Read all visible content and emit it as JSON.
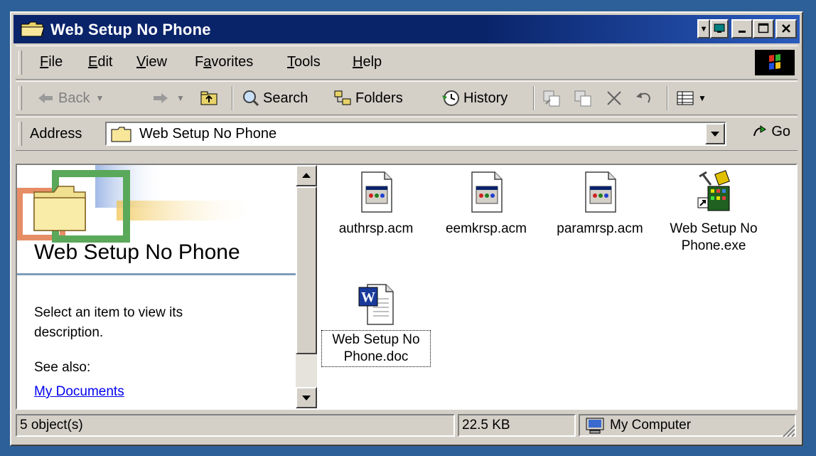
{
  "window": {
    "title": "Web Setup No Phone"
  },
  "menu": {
    "items": [
      {
        "label": "File",
        "key": "F"
      },
      {
        "label": "Edit",
        "key": "E"
      },
      {
        "label": "View",
        "key": "V"
      },
      {
        "label": "Favorites",
        "key": "a"
      },
      {
        "label": "Tools",
        "key": "T"
      },
      {
        "label": "Help",
        "key": "H"
      }
    ]
  },
  "toolbar": {
    "back_label": "Back",
    "search_label": "Search",
    "folders_label": "Folders",
    "history_label": "History"
  },
  "address": {
    "label": "Address",
    "value": "Web Setup No Phone",
    "go_label": "Go"
  },
  "leftpane": {
    "title": "Web Setup No Phone",
    "description": "Select an item to view its description.",
    "see_also": "See also:",
    "link": "My Documents"
  },
  "files": [
    {
      "name": "authrsp.acm",
      "icon": "acm-file-icon"
    },
    {
      "name": "eemkrsp.acm",
      "icon": "acm-file-icon"
    },
    {
      "name": "paramrsp.acm",
      "icon": "acm-file-icon"
    },
    {
      "name": "Web Setup No Phone.exe",
      "icon": "setup-exe-icon"
    },
    {
      "name": "Web Setup No Phone.doc",
      "icon": "word-doc-icon",
      "selected": true
    }
  ],
  "status": {
    "objects": "5 object(s)",
    "size": "22.5 KB",
    "location": "My Computer"
  },
  "colors": {
    "titlebar": "#0a246a",
    "desktop": "#2d6098",
    "face": "#d4d0c8",
    "link": "#0000ee"
  }
}
